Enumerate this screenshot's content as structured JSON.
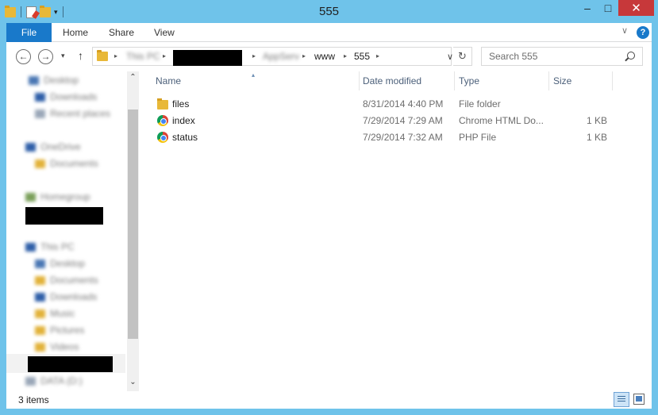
{
  "window": {
    "title": "555",
    "minimize_glyph": "–",
    "maximize_glyph": "□",
    "close_glyph": "✕"
  },
  "ribbon": {
    "tabs": [
      {
        "label": "File"
      },
      {
        "label": "Home"
      },
      {
        "label": "Share"
      },
      {
        "label": "View"
      }
    ],
    "help_glyph": "?"
  },
  "address": {
    "crumbs": [
      "This PC",
      "AppServ",
      "www",
      "555"
    ],
    "search_placeholder": "Search 555"
  },
  "navpane": {
    "items": [
      {
        "label": "Desktop",
        "icon": "desktop-icon"
      },
      {
        "label": "Downloads",
        "icon": "downloads-icon"
      },
      {
        "label": "Recent places",
        "icon": "recent-places-icon"
      },
      {
        "label": "OneDrive",
        "icon": "onedrive-icon"
      },
      {
        "label": "Documents",
        "icon": "folder-icon"
      },
      {
        "label": "Homegroup",
        "icon": "homegroup-icon"
      },
      {
        "label": "This PC",
        "icon": "computer-icon"
      },
      {
        "label": "Desktop",
        "icon": "desktop-icon"
      },
      {
        "label": "Documents",
        "icon": "documents-icon"
      },
      {
        "label": "Downloads",
        "icon": "downloads-icon"
      },
      {
        "label": "Music",
        "icon": "music-icon"
      },
      {
        "label": "Pictures",
        "icon": "pictures-icon"
      },
      {
        "label": "Videos",
        "icon": "videos-icon"
      },
      {
        "label": "DATA (D:)",
        "icon": "drive-icon"
      }
    ]
  },
  "filelist": {
    "columns": {
      "name": "Name",
      "date": "Date modified",
      "type": "Type",
      "size": "Size"
    },
    "rows": [
      {
        "name": "files",
        "date": "8/31/2014 4:40 PM",
        "type": "File folder",
        "size": "",
        "icon": "folder-icon"
      },
      {
        "name": "index",
        "date": "7/29/2014 7:29 AM",
        "type": "Chrome HTML Do...",
        "size": "1 KB",
        "icon": "chrome-icon"
      },
      {
        "name": "status",
        "date": "7/29/2014 7:32 AM",
        "type": "PHP File",
        "size": "1 KB",
        "icon": "chrome-icon"
      }
    ]
  },
  "status": {
    "items_count": "3 items"
  }
}
